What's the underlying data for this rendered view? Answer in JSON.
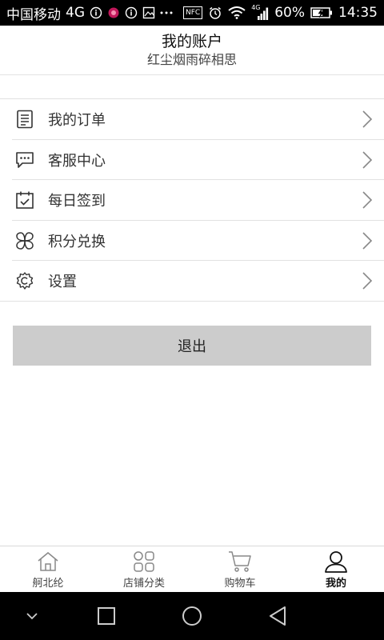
{
  "status_bar": {
    "carrier": "中国移动",
    "network": "4G",
    "battery": "60%",
    "time": "14:35",
    "nfc": "NFC",
    "signal_label": "4G"
  },
  "header": {
    "title": "我的账户",
    "username": "红尘烟雨碎相思"
  },
  "menu": {
    "items": [
      {
        "label": "我的订单",
        "icon": "order-list-icon"
      },
      {
        "label": "客服中心",
        "icon": "chat-bubble-icon"
      },
      {
        "label": "每日签到",
        "icon": "calendar-check-icon"
      },
      {
        "label": "积分兑换",
        "icon": "points-flower-icon"
      },
      {
        "label": "设置",
        "icon": "settings-gear-icon"
      }
    ]
  },
  "logout": {
    "label": "退出"
  },
  "tabbar": {
    "tabs": [
      {
        "label": "舸北纶",
        "icon": "home-icon",
        "active": false
      },
      {
        "label": "店铺分类",
        "icon": "category-grid-icon",
        "active": false
      },
      {
        "label": "购物车",
        "icon": "shopping-cart-icon",
        "active": false
      },
      {
        "label": "我的",
        "icon": "user-profile-icon",
        "active": true
      }
    ]
  },
  "colors": {
    "status_bar_bg": "#000000",
    "logout_bg": "#cccccc",
    "divider": "#e2e2e2"
  }
}
